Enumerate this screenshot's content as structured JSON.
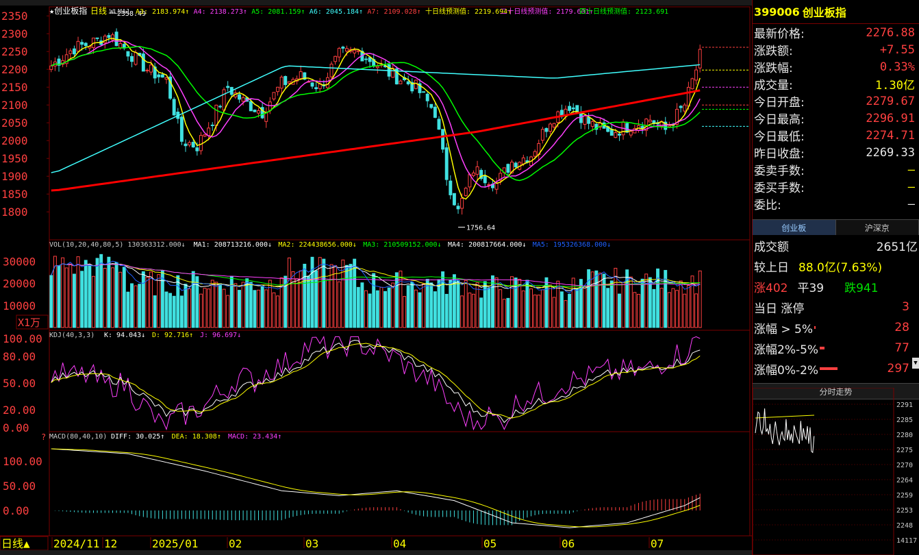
{
  "main": {
    "title": "★创业板指",
    "period": "日线",
    "indicator": "WLMA1",
    "ma_items": [
      {
        "label": "A3: 2183.974↑",
        "color": "#ffff00"
      },
      {
        "label": "A4: 2138.273↑",
        "color": "#ff40ff"
      },
      {
        "label": "A5: 2081.159↑",
        "color": "#00ff00"
      },
      {
        "label": "A6: 2045.184↑",
        "color": "#40ffff"
      },
      {
        "label": "A7: 2109.028↑",
        "color": "#ff4040"
      },
      {
        "label": "十日线预测值: 2219.694↑",
        "color": "#ffff00"
      },
      {
        "label": "二十日线预测值: 2179.601↑",
        "color": "#ff40ff"
      },
      {
        "label": "四十日线预测值: 2123.691",
        "color": "#00ff00"
      }
    ],
    "y_ticks": [
      "2350",
      "2300",
      "2250",
      "2200",
      "2150",
      "2100",
      "2050",
      "2000",
      "1950",
      "1900",
      "1850",
      "1800"
    ],
    "high_label": "2358.49",
    "low_label": "1756.64"
  },
  "volume": {
    "header": "VOL(10,20,40,80,5) 130363312.000↓",
    "items": [
      {
        "label": "MA1: 208713216.000↓",
        "color": "#ffffff"
      },
      {
        "label": "MA2: 224438656.000↓",
        "color": "#ffff00"
      },
      {
        "label": "MA3: 210509152.000↓",
        "color": "#00ff00"
      },
      {
        "label": "MA4: 200817664.000↓",
        "color": "#ffffff"
      },
      {
        "label": "MA5: 195326368.000↓",
        "color": "#2060ff"
      }
    ],
    "y_ticks": [
      "30000",
      "20000",
      "10000"
    ],
    "unit": "X1万"
  },
  "kdj": {
    "header": "KDJ(40,3,3)",
    "items": [
      {
        "label": "K: 94.043↓",
        "color": "#ffffff"
      },
      {
        "label": "D: 92.716↑",
        "color": "#ffff00"
      },
      {
        "label": "J: 96.697↓",
        "color": "#ff40ff"
      }
    ],
    "y_ticks": [
      "100.00",
      "80.00",
      "50.00",
      "20.00",
      "0.00"
    ]
  },
  "macd": {
    "header": "MACD(80,40,10)",
    "items": [
      {
        "label": "DIFF: 30.025↑",
        "color": "#ffffff"
      },
      {
        "label": "DEA: 18.308↑",
        "color": "#ffff00"
      },
      {
        "label": "MACD: 23.434↑",
        "color": "#ff40ff"
      }
    ],
    "y_ticks": [
      "100.00",
      "50.00",
      "0.00"
    ]
  },
  "bottom": {
    "period_button": "日线▲",
    "dates": [
      "2024/11",
      "12",
      "2025/01",
      "02",
      "03",
      "04",
      "05",
      "06",
      "07"
    ]
  },
  "quote": {
    "code": "399006",
    "name": "创业板指",
    "rows": [
      {
        "label": "最新价格:",
        "value": "2276.88",
        "color": "red"
      },
      {
        "label": "涨跌额:",
        "value": "+7.55",
        "color": "red"
      },
      {
        "label": "涨跌幅:",
        "value": "0.33%",
        "color": "red"
      },
      {
        "label": "成交量:",
        "value": "1.30亿",
        "color": "yel"
      },
      {
        "label": "今日开盘:",
        "value": "2279.67",
        "color": "red"
      },
      {
        "label": "今日最高:",
        "value": "2296.91",
        "color": "red"
      },
      {
        "label": "今日最低:",
        "value": "2274.71",
        "color": "red"
      },
      {
        "label": "昨日收盘:",
        "value": "2269.33",
        "color": "wht"
      },
      {
        "label": "委卖手数:",
        "value": "—",
        "color": "yel"
      },
      {
        "label": "委买手数:",
        "value": "—",
        "color": "yel"
      },
      {
        "label": "委比:",
        "value": "—",
        "color": "wht"
      }
    ],
    "tabs": [
      "创业板",
      "沪深京"
    ]
  },
  "stats": {
    "turnover_label": "成交额",
    "turnover": "2651亿",
    "vs_prev_label": "较上日",
    "vs_prev": "88.0亿(7.63%)",
    "up_label": "涨402",
    "flat_label": "平39",
    "down_label": "跌941",
    "limit_label": "当日 涨停",
    "limit_value": "3",
    "gt5_label": "涨幅 > 5%",
    "gt5_value": "28",
    "r25_label": "涨幅2%-5%",
    "r25_value": "77",
    "r02_label": "涨幅0%-2%",
    "r02_value": "297"
  },
  "intraday": {
    "title": "分时走势",
    "y_ticks": [
      "2291",
      "2285",
      "2280",
      "2275",
      "2270",
      "2264",
      "2259",
      "2253",
      "2248",
      "14117"
    ]
  },
  "colors": {
    "up": "#ff4040",
    "down": "#40e0e0",
    "frame": "#7a0000"
  }
}
